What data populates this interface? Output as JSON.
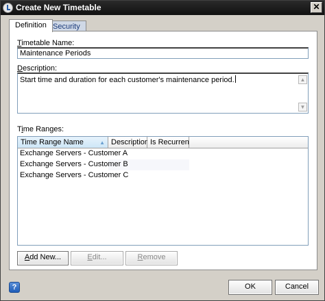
{
  "window": {
    "title": "Create New Timetable",
    "close_symbol": "✕"
  },
  "tabs": [
    {
      "label": "Definition",
      "active": true
    },
    {
      "label": "Security",
      "active": false
    }
  ],
  "form": {
    "timetable_name": {
      "label_hotkey": "T",
      "label_rest": "imetable Name:",
      "value": "Maintenance Periods"
    },
    "description": {
      "label_hotkey": "D",
      "label_rest": "escription:",
      "value": "Start time and duration for each customer's maintenance period."
    }
  },
  "time_ranges": {
    "label_prefix": "T",
    "label_hotkey": "i",
    "label_rest": "me Ranges:",
    "columns": [
      "Time Range Name",
      "Description",
      "Is Recurrent"
    ],
    "rows": [
      {
        "name": "Exchange Servers - Customer A",
        "description": "",
        "is_recurrent": ""
      },
      {
        "name": "Exchange Servers - Customer B",
        "description": "",
        "is_recurrent": ""
      },
      {
        "name": "Exchange Servers - Customer C",
        "description": "",
        "is_recurrent": ""
      }
    ]
  },
  "buttons": {
    "add_new": {
      "hotkey": "A",
      "rest": "dd New...",
      "enabled": true
    },
    "edit": {
      "hotkey": "E",
      "rest": "dit...",
      "enabled": false
    },
    "remove": {
      "hotkey": "R",
      "rest": "emove",
      "enabled": false
    },
    "ok": "OK",
    "cancel": "Cancel",
    "help": "?"
  },
  "colors": {
    "title_bar": "#1a1a1a",
    "dialog_bg": "#d4d0c8",
    "header_sorted": "#cde6f7"
  }
}
